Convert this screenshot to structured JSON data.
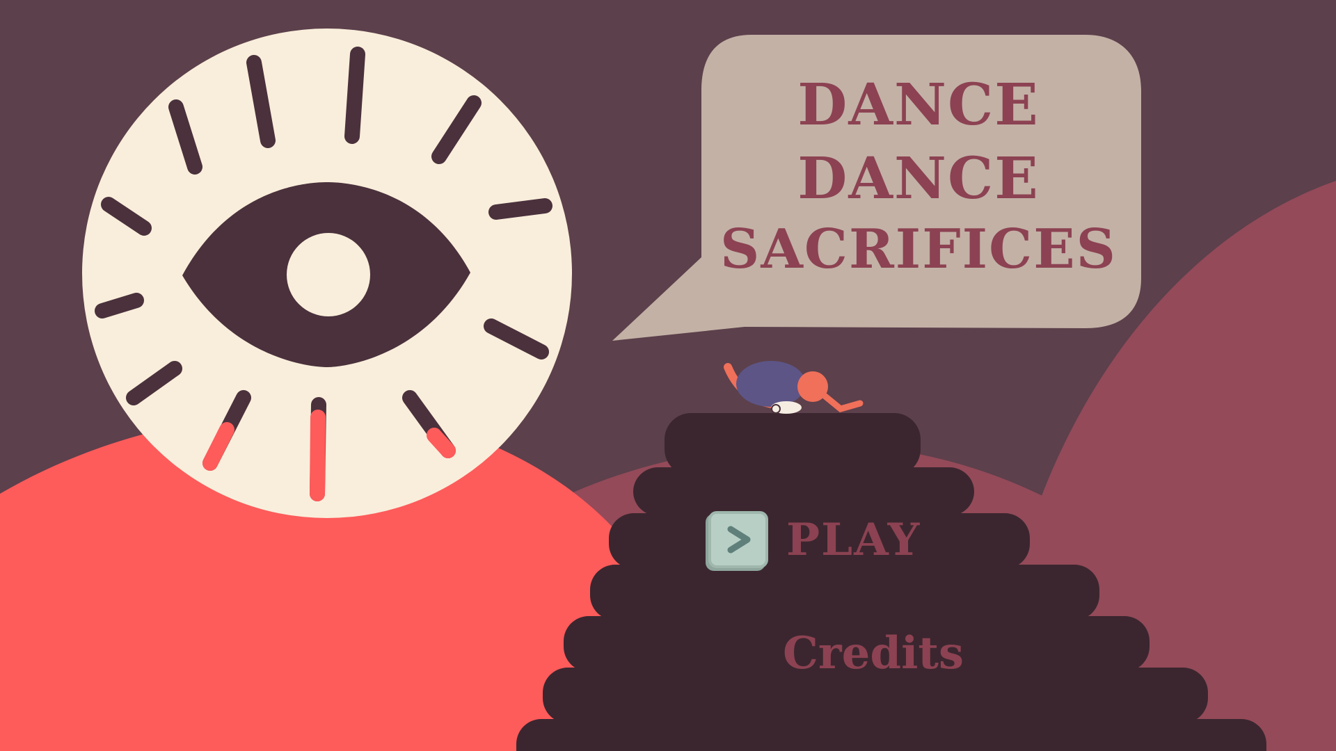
{
  "game": {
    "title_lines": [
      "DANCE",
      "DANCE",
      "SACRIFICES"
    ],
    "menu": {
      "play_label": "PLAY",
      "credits_label": "Credits"
    },
    "icons": {
      "play_key": "play-arrow-key-icon",
      "eye_emblem": "all-seeing-eye-icon"
    },
    "colors": {
      "background": "#5c404b",
      "hill_crimson": "#944a59",
      "hill_coral": "#fe5b5b",
      "pyramid": "#3b262f",
      "sun_disc": "#f9eedb",
      "eye_dark": "#4a313c",
      "speech_bubble": "#c3b1a6",
      "title_text": "#8c4252",
      "key_button": "#b7cfc5"
    }
  }
}
